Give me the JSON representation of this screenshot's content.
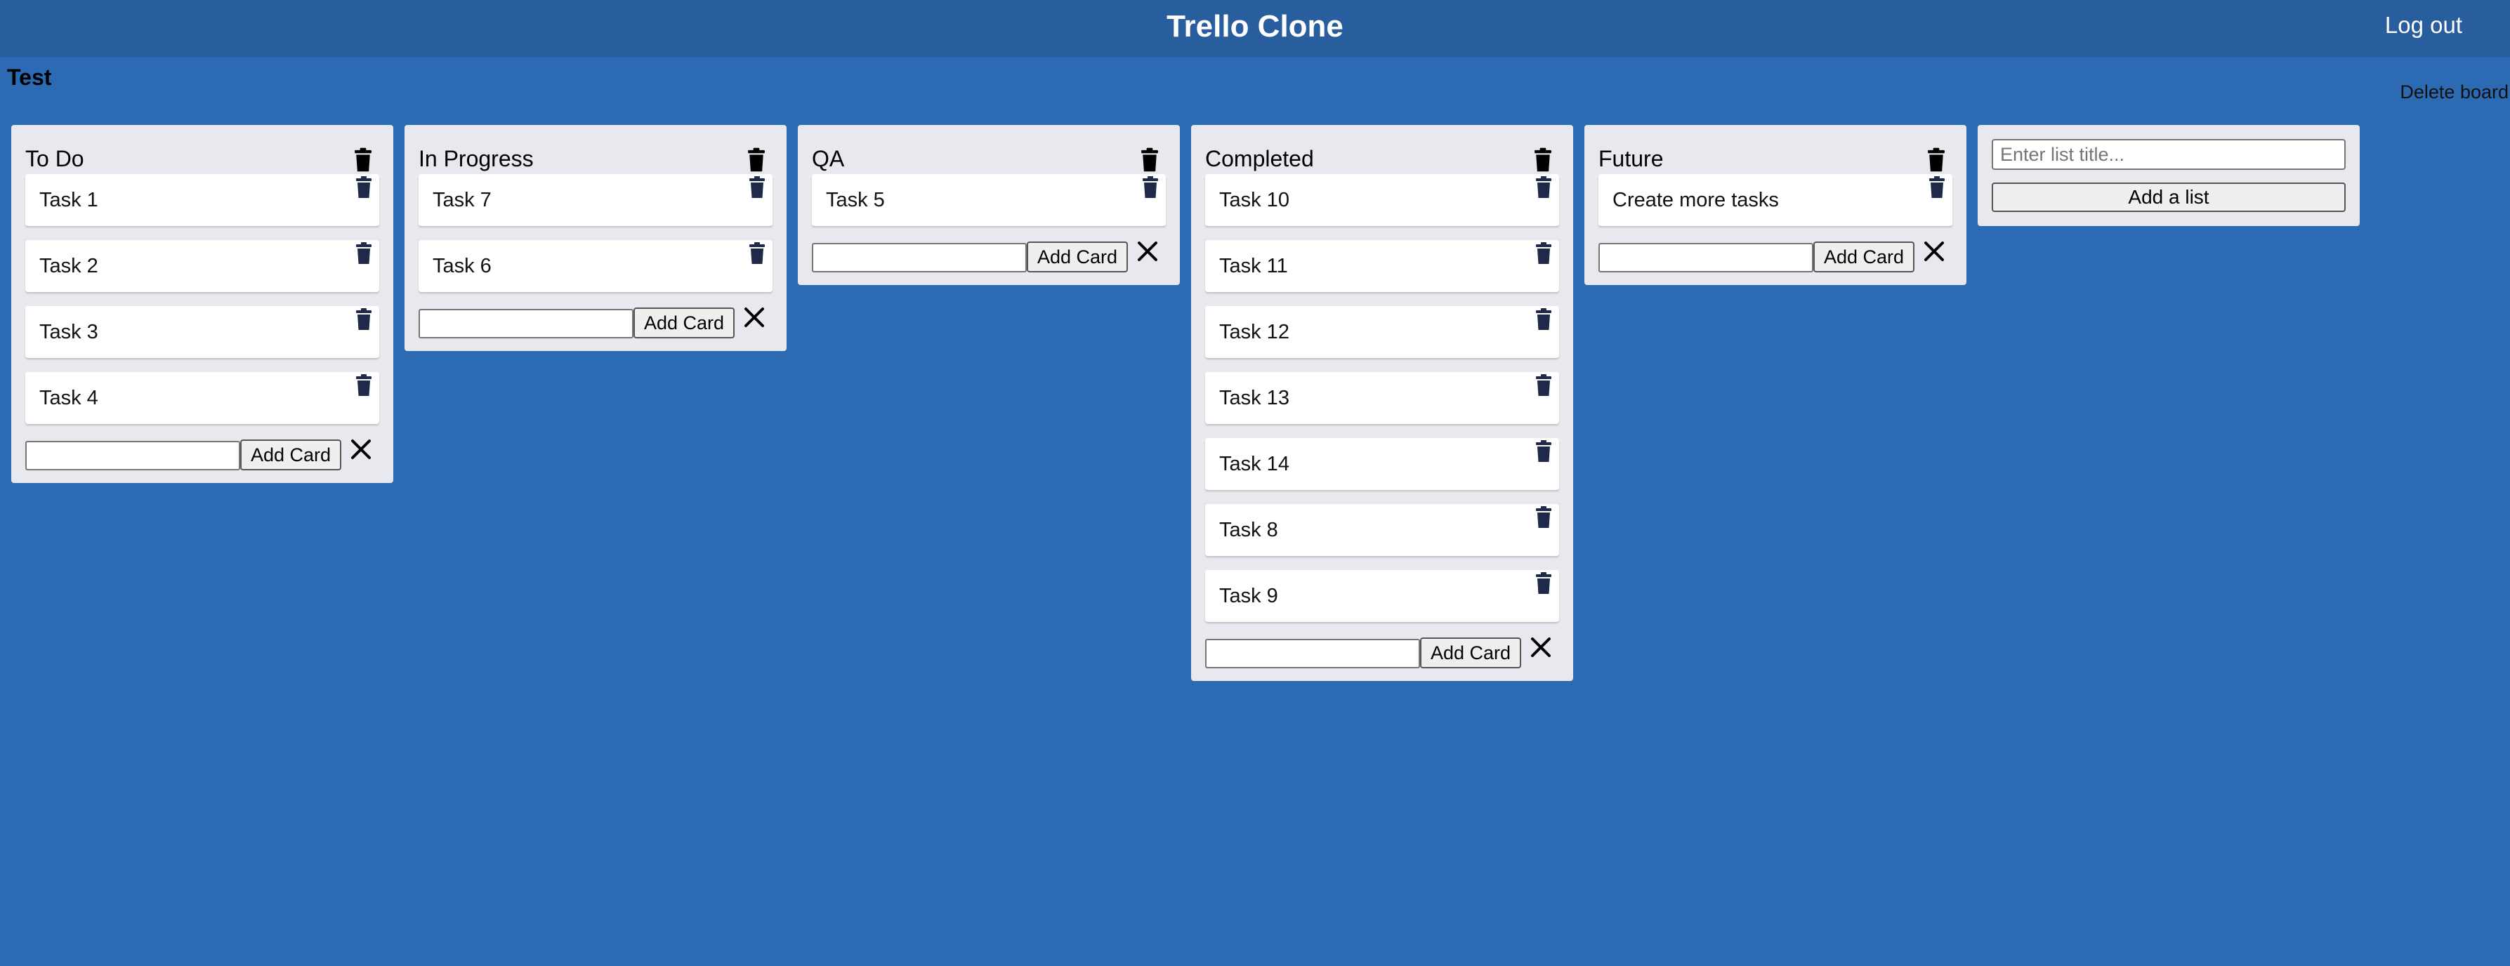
{
  "header": {
    "title": "Trello Clone",
    "logout_label": "Log out"
  },
  "board": {
    "title": "Test",
    "delete_label": "Delete board"
  },
  "lists": [
    {
      "title": "To Do",
      "cards": [
        "Task 1",
        "Task 2",
        "Task 3",
        "Task 4"
      ]
    },
    {
      "title": "In Progress",
      "cards": [
        "Task 7",
        "Task 6"
      ]
    },
    {
      "title": "QA",
      "cards": [
        "Task 5"
      ]
    },
    {
      "title": "Completed",
      "cards": [
        "Task 10",
        "Task 11",
        "Task 12",
        "Task 13",
        "Task 14",
        "Task 8",
        "Task 9"
      ]
    },
    {
      "title": "Future",
      "cards": [
        "Create more tasks"
      ]
    }
  ],
  "add_card_label": "Add Card",
  "new_list": {
    "placeholder": "Enter list title...",
    "button_label": "Add a list"
  },
  "icons": {
    "delete": "trash-icon",
    "cancel": "close-icon"
  },
  "colors": {
    "background": "#2c6ab4",
    "header": "#285d9e",
    "list": "#e8e9ee",
    "card": "#ffffff",
    "trash_list": "#000000",
    "trash_card": "#1f2a4a"
  }
}
